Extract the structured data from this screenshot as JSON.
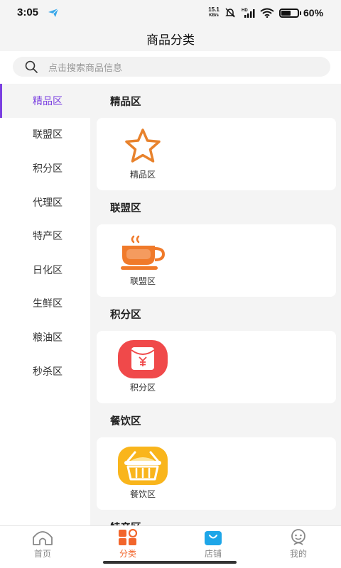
{
  "status_bar": {
    "time": "3:05",
    "net_speed_value": "15.1",
    "net_speed_unit": "KB/s",
    "signal_label": "HD",
    "battery_level": 0.6,
    "battery_text": "60%"
  },
  "header": {
    "title": "商品分类"
  },
  "search": {
    "placeholder": "点击搜索商品信息"
  },
  "sidebar": {
    "items": [
      {
        "label": "精品区",
        "active": true
      },
      {
        "label": "联盟区"
      },
      {
        "label": "积分区"
      },
      {
        "label": "代理区"
      },
      {
        "label": "特产区"
      },
      {
        "label": "日化区"
      },
      {
        "label": "生鲜区"
      },
      {
        "label": "粮油区"
      },
      {
        "label": "秒杀区"
      }
    ]
  },
  "sections": [
    {
      "title": "精品区",
      "tile_label": "精品区",
      "icon": "star-icon"
    },
    {
      "title": "联盟区",
      "tile_label": "联盟区",
      "icon": "coffee-cup-icon"
    },
    {
      "title": "积分区",
      "tile_label": "积分区",
      "icon": "red-packet-icon"
    },
    {
      "title": "餐饮区",
      "tile_label": "餐饮区",
      "icon": "basket-icon"
    },
    {
      "title": "特产区"
    }
  ],
  "tabbar": {
    "tabs": [
      {
        "label": "首页",
        "icon": "home-icon"
      },
      {
        "label": "分类",
        "icon": "category-icon",
        "active": true
      },
      {
        "label": "店铺",
        "icon": "shop-bag-icon"
      },
      {
        "label": "我的",
        "icon": "profile-icon"
      }
    ]
  },
  "colors": {
    "accent_purple": "#7a3fe0",
    "accent_orange": "#f2652b",
    "star_orange": "#e8822c",
    "cup_orange": "#f07a2a",
    "packet_red": "#f0494a",
    "basket_yellow": "#f9b51c"
  }
}
